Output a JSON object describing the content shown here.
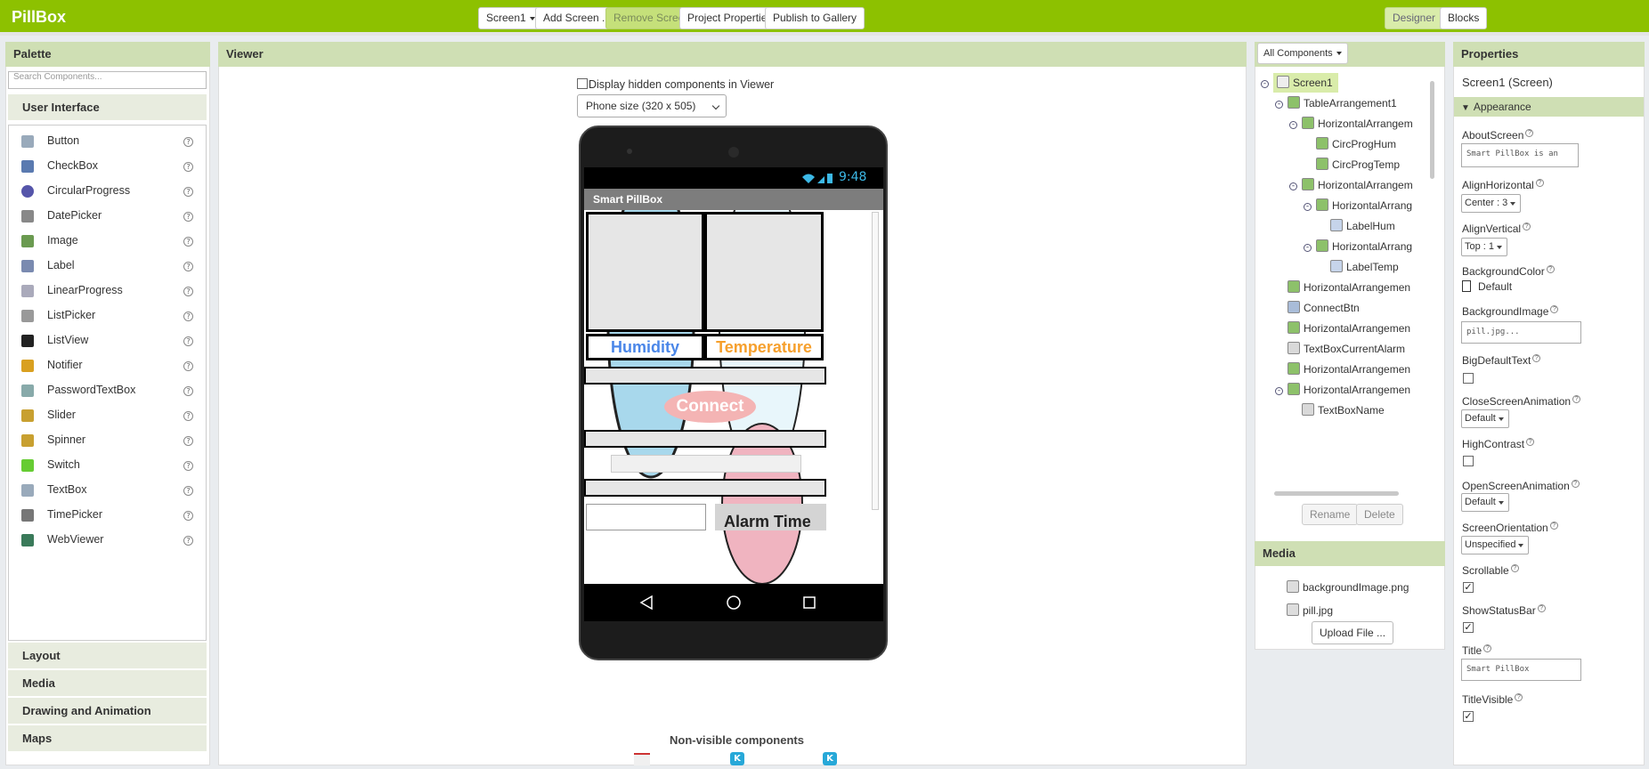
{
  "app": {
    "title": "PillBox"
  },
  "toolbar": {
    "screen_select": "Screen1",
    "add_screen": "Add Screen ...",
    "remove_screen": "Remove Screen",
    "project_properties": "Project Properties",
    "publish": "Publish to Gallery",
    "designer": "Designer",
    "blocks": "Blocks"
  },
  "palette": {
    "title": "Palette",
    "search_placeholder": "Search Components...",
    "category_open": "User Interface",
    "items": [
      {
        "label": "Button",
        "icon": "button-icon"
      },
      {
        "label": "CheckBox",
        "icon": "checkbox-icon"
      },
      {
        "label": "CircularProgress",
        "icon": "circular-progress-icon"
      },
      {
        "label": "DatePicker",
        "icon": "date-picker-icon"
      },
      {
        "label": "Image",
        "icon": "image-icon"
      },
      {
        "label": "Label",
        "icon": "label-icon"
      },
      {
        "label": "LinearProgress",
        "icon": "linear-progress-icon"
      },
      {
        "label": "ListPicker",
        "icon": "list-picker-icon"
      },
      {
        "label": "ListView",
        "icon": "list-view-icon"
      },
      {
        "label": "Notifier",
        "icon": "notifier-icon"
      },
      {
        "label": "PasswordTextBox",
        "icon": "password-icon"
      },
      {
        "label": "Slider",
        "icon": "slider-icon"
      },
      {
        "label": "Spinner",
        "icon": "spinner-icon"
      },
      {
        "label": "Switch",
        "icon": "switch-icon"
      },
      {
        "label": "TextBox",
        "icon": "textbox-icon"
      },
      {
        "label": "TimePicker",
        "icon": "time-picker-icon"
      },
      {
        "label": "WebViewer",
        "icon": "web-viewer-icon"
      }
    ],
    "categories": [
      "Layout",
      "Media",
      "Drawing and Animation",
      "Maps"
    ]
  },
  "viewer": {
    "title": "Viewer",
    "hidden_label": "Display hidden components in Viewer",
    "phone_size": "Phone size (320 x 505)",
    "status_time": "9:48",
    "app_title": "Smart PillBox",
    "humidity": "Humidity",
    "temperature": "Temperature",
    "connect": "Connect",
    "alarm": "Alarm Time",
    "nonvisible": "Non-visible components",
    "colors": {
      "humidity": "#4a86e8",
      "temperature": "#f6a02d",
      "connect": "#f4b4b4"
    }
  },
  "components": {
    "filter": "All Components",
    "tree": [
      {
        "label": "Screen1",
        "level": 0,
        "toggle": true,
        "selected": true
      },
      {
        "label": "TableArrangement1",
        "level": 1,
        "toggle": true
      },
      {
        "label": "HorizontalArrangem",
        "level": 2,
        "toggle": true
      },
      {
        "label": "CircProgHum",
        "level": 3
      },
      {
        "label": "CircProgTemp",
        "level": 3
      },
      {
        "label": "HorizontalArrangem",
        "level": 2,
        "toggle": true
      },
      {
        "label": "HorizontalArrang",
        "level": 3,
        "toggle": true
      },
      {
        "label": "LabelHum",
        "level": 4
      },
      {
        "label": "HorizontalArrang",
        "level": 3,
        "toggle": true
      },
      {
        "label": "LabelTemp",
        "level": 4
      },
      {
        "label": "HorizontalArrangemen",
        "level": 1
      },
      {
        "label": "ConnectBtn",
        "level": 1
      },
      {
        "label": "HorizontalArrangemen",
        "level": 1
      },
      {
        "label": "TextBoxCurrentAlarm",
        "level": 1
      },
      {
        "label": "HorizontalArrangemen",
        "level": 1
      },
      {
        "label": "HorizontalArrangemen",
        "level": 1,
        "toggle": true
      },
      {
        "label": "TextBoxName",
        "level": 2
      }
    ],
    "rename": "Rename",
    "delete": "Delete"
  },
  "media": {
    "title": "Media",
    "files": [
      "backgroundImage.png",
      "pill.jpg"
    ],
    "upload": "Upload File ..."
  },
  "properties": {
    "title": "Properties",
    "screen": "Screen1 (Screen)",
    "section": "Appearance",
    "about_label": "AboutScreen",
    "about_value": "Smart PillBox is an",
    "align_h_label": "AlignHorizontal",
    "align_h_value": "Center : 3",
    "align_v_label": "AlignVertical",
    "align_v_value": "Top : 1",
    "bg_color_label": "BackgroundColor",
    "bg_color_value": "Default",
    "bg_image_label": "BackgroundImage",
    "bg_image_value": "pill.jpg...",
    "big_text_label": "BigDefaultText",
    "close_anim_label": "CloseScreenAnimation",
    "close_anim_value": "Default",
    "high_contrast_label": "HighContrast",
    "open_anim_label": "OpenScreenAnimation",
    "open_anim_value": "Default",
    "orientation_label": "ScreenOrientation",
    "orientation_value": "Unspecified",
    "scrollable_label": "Scrollable",
    "statusbar_label": "ShowStatusBar",
    "title_label": "Title",
    "title_value": "Smart PillBox",
    "title_visible_label": "TitleVisible"
  }
}
